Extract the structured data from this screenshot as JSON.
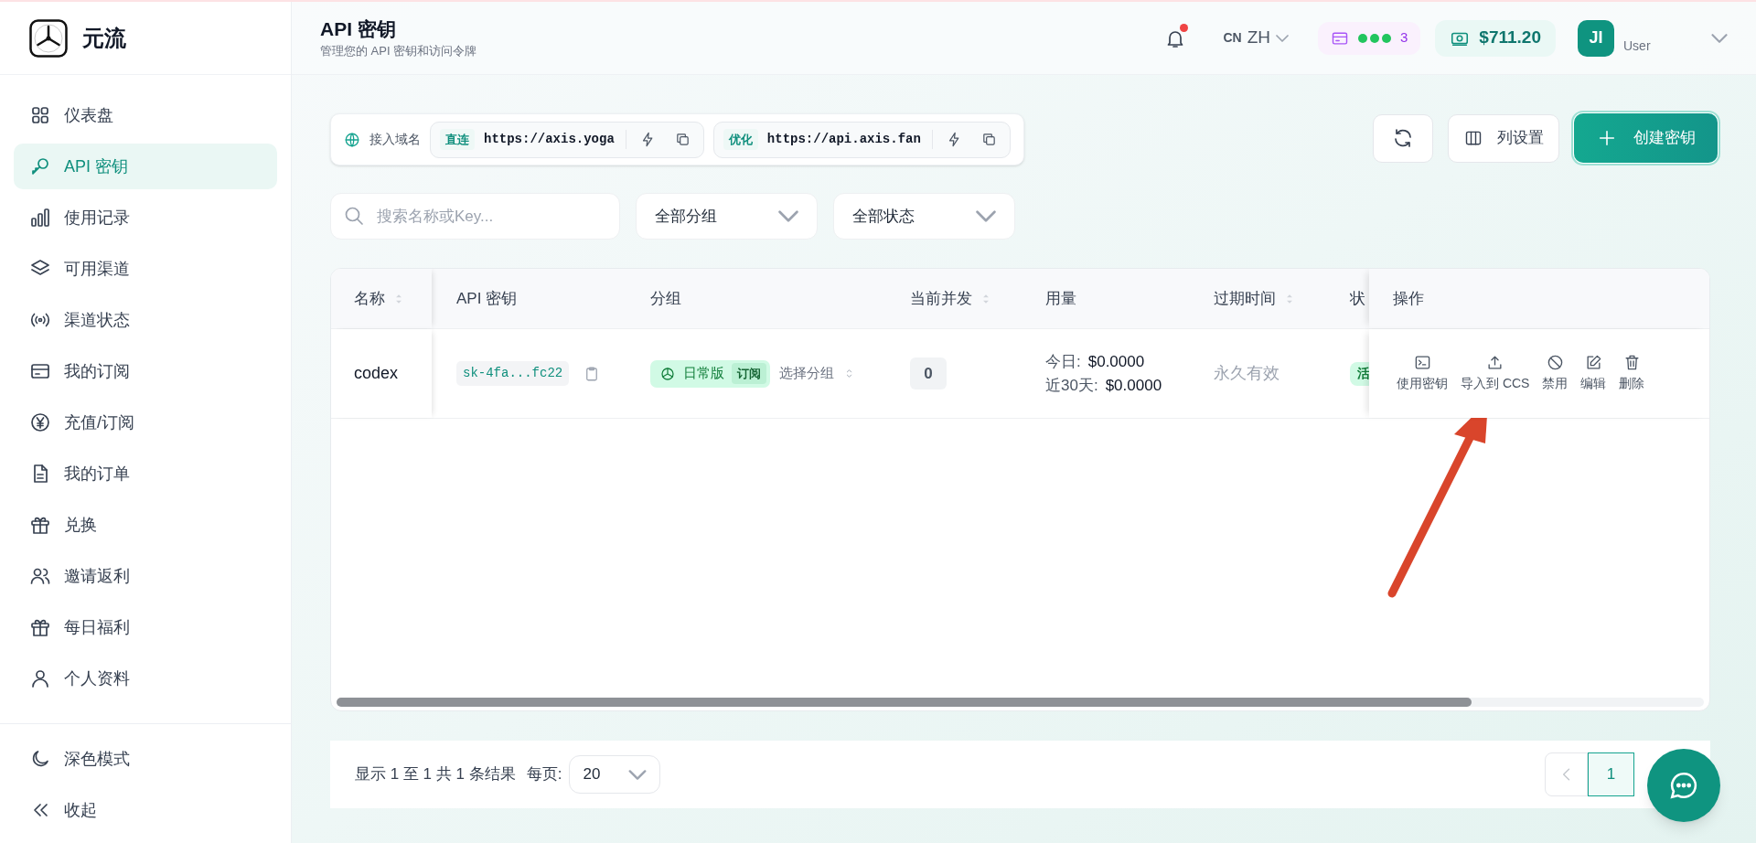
{
  "brand": {
    "name": "元流"
  },
  "sidebar": {
    "items": [
      {
        "kind": "dashboard",
        "label": "仪表盘",
        "selected": false
      },
      {
        "kind": "key",
        "label": "API 密钥",
        "selected": true
      },
      {
        "kind": "chart",
        "label": "使用记录",
        "selected": false
      },
      {
        "kind": "layers",
        "label": "可用渠道",
        "selected": false
      },
      {
        "kind": "signal",
        "label": "渠道状态",
        "selected": false
      },
      {
        "kind": "card",
        "label": "我的订阅",
        "selected": false
      },
      {
        "kind": "yen",
        "label": "充值/订阅",
        "selected": false
      },
      {
        "kind": "document",
        "label": "我的订单",
        "selected": false
      },
      {
        "kind": "gift",
        "label": "兑换",
        "selected": false
      },
      {
        "kind": "users",
        "label": "邀请返利",
        "selected": false
      },
      {
        "kind": "gift",
        "label": "每日福利",
        "selected": false
      },
      {
        "kind": "user",
        "label": "个人资料",
        "selected": false
      }
    ],
    "footer": [
      {
        "kind": "moon",
        "label": "深色模式"
      },
      {
        "kind": "collapse",
        "label": "收起"
      }
    ]
  },
  "header": {
    "title": "API 密钥",
    "subtitle": "管理您的 API 密钥和访问令牌",
    "notification": {
      "unread": true
    },
    "language": {
      "region": "CN",
      "code": "ZH"
    },
    "subscription": {
      "count": "3"
    },
    "balance": "$711.20",
    "user": {
      "initials": "JI",
      "role": "User"
    }
  },
  "domains": {
    "label": "接入域名",
    "entries": [
      {
        "tag": "直连",
        "url": "https://axis.yoga"
      },
      {
        "tag": "优化",
        "url": "https://api.axis.fan"
      }
    ]
  },
  "toolbar": {
    "buttons": [
      {
        "kind": "refresh"
      },
      {
        "kind": "columns",
        "label": "列设置"
      },
      {
        "kind": "create",
        "label": "创建密钥"
      }
    ]
  },
  "filters": {
    "search": {
      "placeholder": "搜索名称或Key..."
    },
    "dropdowns": [
      {
        "value": "全部分组"
      },
      {
        "value": "全部状态"
      }
    ]
  },
  "table": {
    "columns": [
      {
        "label": "名称",
        "sortable": true
      },
      {
        "label": "API 密钥",
        "sortable": false
      },
      {
        "label": "分组",
        "sortable": false
      },
      {
        "label": "当前并发",
        "sortable": true
      },
      {
        "label": "用量",
        "sortable": false
      },
      {
        "label": "过期时间",
        "sortable": true
      },
      {
        "label": "状"
      },
      {
        "label": "操作",
        "sortable": false
      }
    ],
    "rows": [
      {
        "name": "codex",
        "key": "sk-4fa...fc22",
        "group": {
          "name": "日常版",
          "tag": "订阅"
        },
        "group_select": "选择分组",
        "concurrency": "0",
        "usage": [
          {
            "label": "今日:",
            "value": "$0.0000"
          },
          {
            "label": "近30天:",
            "value": "$0.0000"
          }
        ],
        "expires": "永久有效",
        "status": "活",
        "actions": [
          {
            "kind": "terminal",
            "label": "使用密钥"
          },
          {
            "kind": "upload",
            "label": "导入到 CCS"
          },
          {
            "kind": "ban",
            "label": "禁用"
          },
          {
            "kind": "edit",
            "label": "编辑"
          },
          {
            "kind": "trash",
            "label": "删除"
          }
        ]
      }
    ]
  },
  "pagination": {
    "summary": "显示 1 至 1 共 1 条结果",
    "per_page_label": "每页:",
    "per_page": "20",
    "pages": [
      {
        "label": "1",
        "selected": true
      }
    ]
  }
}
